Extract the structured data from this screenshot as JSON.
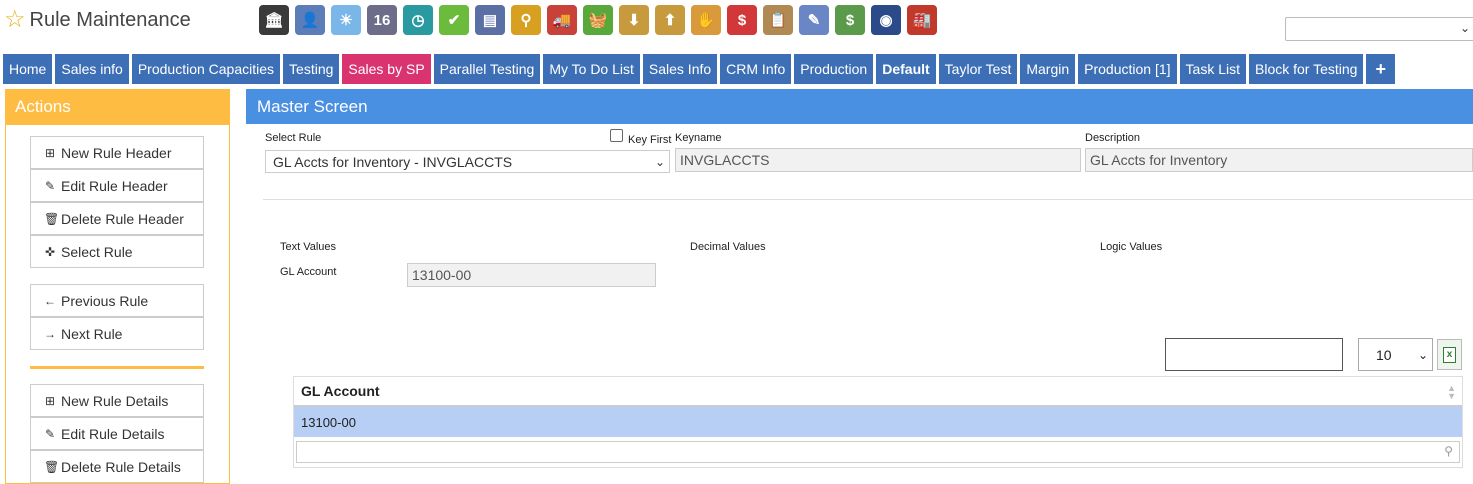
{
  "header": {
    "title": "Rule Maintenance"
  },
  "toolbar_icons": [
    {
      "name": "bank-icon",
      "color": "#3a3a3a",
      "glyph": "🏛"
    },
    {
      "name": "user-icon",
      "color": "#5b7db8",
      "glyph": "👤"
    },
    {
      "name": "weather-icon",
      "color": "#7ab6e8",
      "glyph": "☀"
    },
    {
      "name": "calendar-icon",
      "color": "#6d6d8a",
      "glyph": "16"
    },
    {
      "name": "clock-icon",
      "color": "#2b9aa0",
      "glyph": "◷"
    },
    {
      "name": "checkmark-icon",
      "color": "#6cbb3c",
      "glyph": "✔"
    },
    {
      "name": "screen-icon",
      "color": "#5a6fa3",
      "glyph": "▤"
    },
    {
      "name": "magnifier-icon",
      "color": "#d8a020",
      "glyph": "⚲"
    },
    {
      "name": "truck-icon",
      "color": "#c9423a",
      "glyph": "🚚"
    },
    {
      "name": "basket-icon",
      "color": "#58a83c",
      "glyph": "🧺"
    },
    {
      "name": "download-box-icon",
      "color": "#c79b3d",
      "glyph": "⬇"
    },
    {
      "name": "upload-box-icon",
      "color": "#c79b3d",
      "glyph": "⬆"
    },
    {
      "name": "hand-coins-icon",
      "color": "#d89a3a",
      "glyph": "✋"
    },
    {
      "name": "dollar-bubble-icon",
      "color": "#d2383a",
      "glyph": "$"
    },
    {
      "name": "clipboard-icon",
      "color": "#b08a52",
      "glyph": "📋"
    },
    {
      "name": "pencil-icon",
      "color": "#6a86c4",
      "glyph": "✎"
    },
    {
      "name": "money-icon",
      "color": "#5b9a4a",
      "glyph": "$"
    },
    {
      "name": "globe-book-icon",
      "color": "#2a4a8a",
      "glyph": "◉"
    },
    {
      "name": "factory-icon",
      "color": "#c0392b",
      "glyph": "🏭"
    }
  ],
  "tabs": [
    {
      "label": "Home",
      "style": ""
    },
    {
      "label": "Sales info",
      "style": ""
    },
    {
      "label": "Production Capacities",
      "style": ""
    },
    {
      "label": "Testing",
      "style": ""
    },
    {
      "label": "Sales by SP",
      "style": "pink"
    },
    {
      "label": "Parallel Testing",
      "style": ""
    },
    {
      "label": "My To Do List",
      "style": ""
    },
    {
      "label": "Sales Info",
      "style": ""
    },
    {
      "label": "CRM Info",
      "style": ""
    },
    {
      "label": "Production",
      "style": ""
    },
    {
      "label": "Default",
      "style": "bold"
    },
    {
      "label": "Taylor Test",
      "style": ""
    },
    {
      "label": "Margin",
      "style": ""
    },
    {
      "label": "Production [1]",
      "style": ""
    },
    {
      "label": "Task List",
      "style": ""
    },
    {
      "label": "Block for Testing",
      "style": ""
    },
    {
      "label": "+",
      "style": "plus"
    }
  ],
  "actions": {
    "title": "Actions",
    "buttons": {
      "new_rule_header": "New Rule Header",
      "edit_rule_header": "Edit Rule Header",
      "delete_rule_header": "Delete Rule Header",
      "select_rule": "Select Rule",
      "previous_rule": "Previous Rule",
      "next_rule": "Next Rule",
      "new_rule_details": "New Rule Details",
      "edit_rule_details": "Edit Rule Details",
      "delete_rule_details": "Delete Rule Details"
    }
  },
  "master": {
    "title": "Master Screen",
    "select_rule_label": "Select Rule",
    "select_rule_value": "GL Accts for Inventory - INVGLACCTS",
    "key_first_label": "Key First",
    "keyname_label": "Keyname",
    "keyname_value": "INVGLACCTS",
    "description_label": "Description",
    "description_value": "GL Accts for Inventory",
    "text_values_label": "Text Values",
    "decimal_values_label": "Decimal Values",
    "logic_values_label": "Logic Values",
    "gl_account_label": "GL Account",
    "gl_account_value": "13100-00"
  },
  "grid": {
    "page_size": "10",
    "column_header": "GL Account",
    "rows": [
      "13100-00"
    ]
  }
}
